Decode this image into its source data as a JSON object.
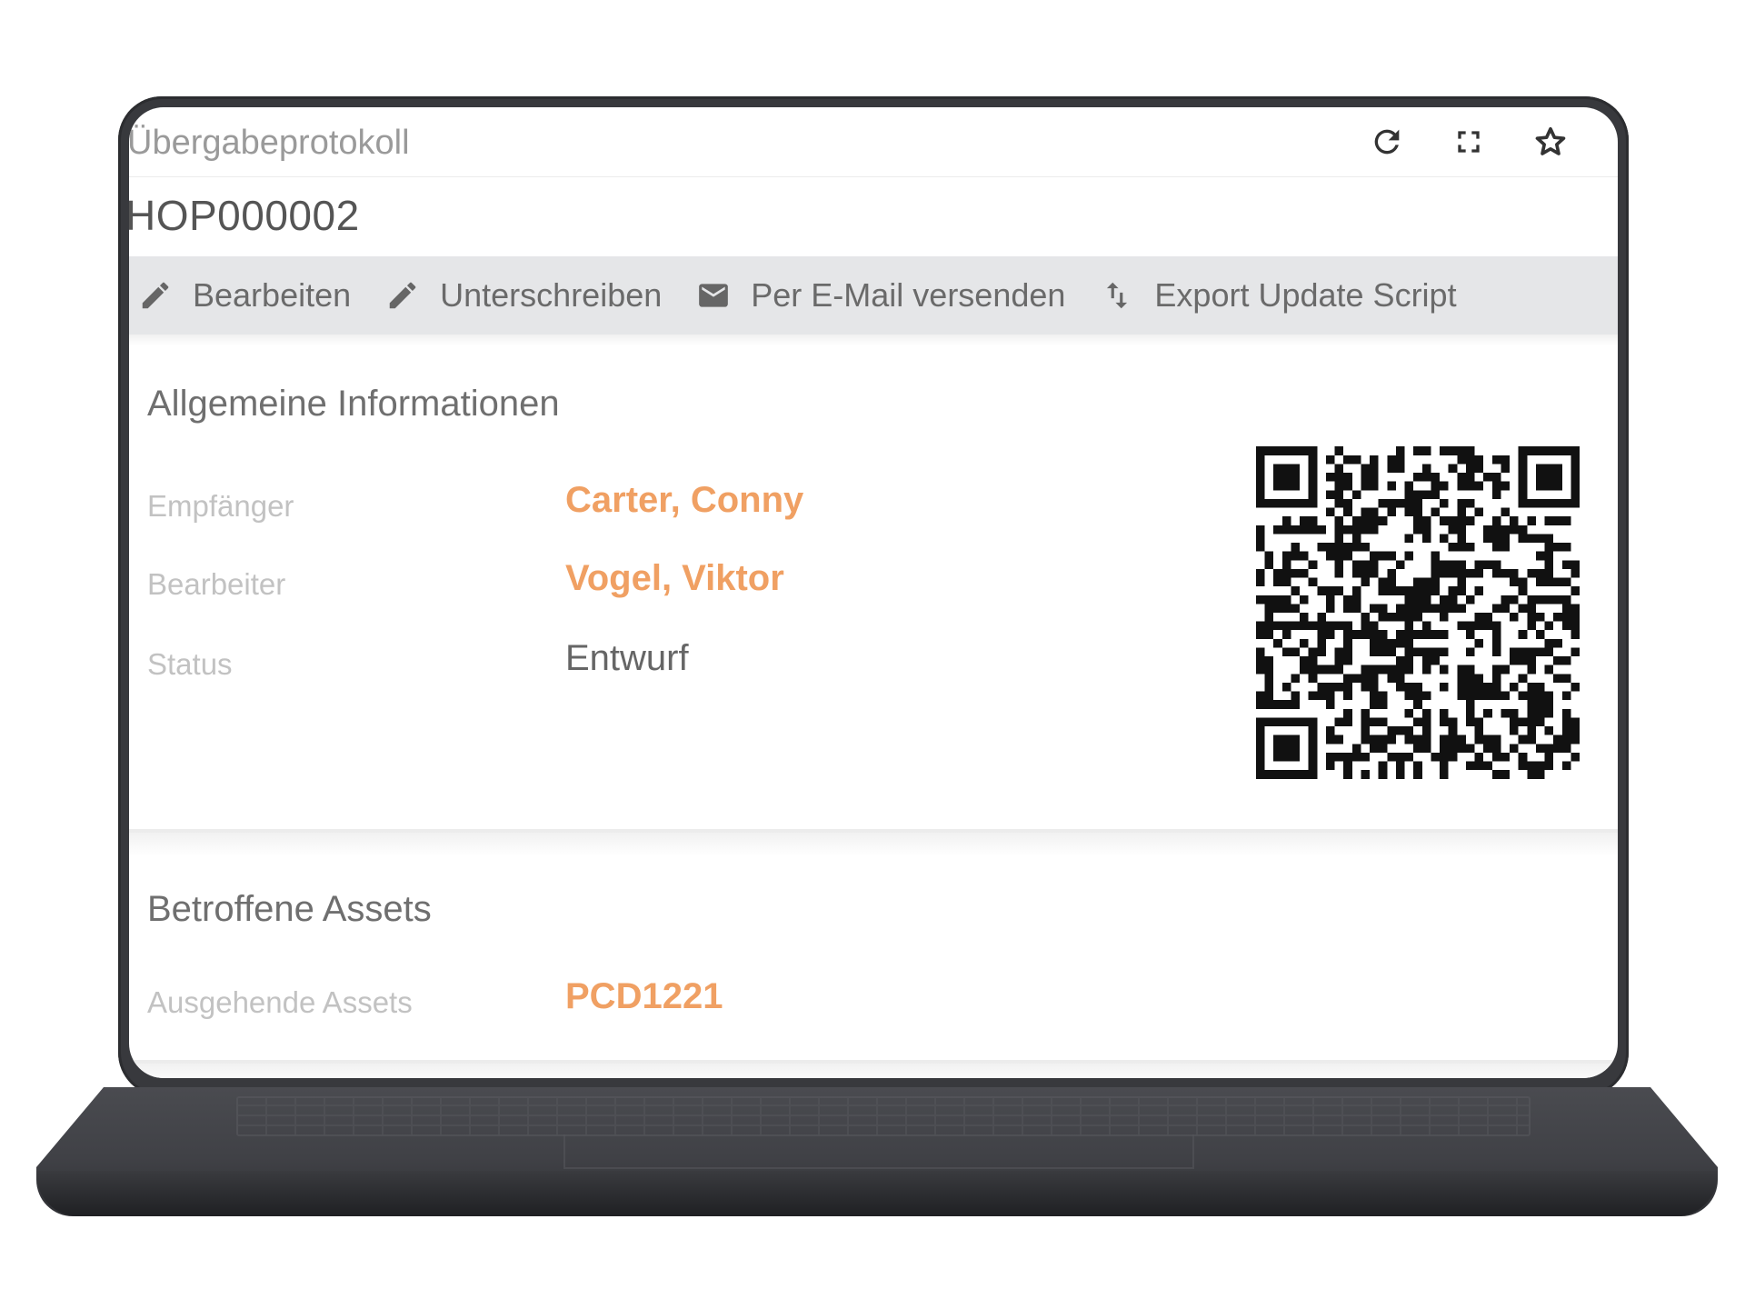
{
  "app": {
    "title": "Übergabeprotokoll"
  },
  "window_icons": [
    "refresh-icon",
    "fullscreen-icon",
    "star-icon"
  ],
  "document": {
    "id": "HOP000002"
  },
  "toolbar": {
    "edit_label": "Bearbeiten",
    "sign_label": "Unterschreiben",
    "email_label": "Per E-Mail versenden",
    "export_label": "Export Update Script"
  },
  "general": {
    "title": "Allgemeine Informationen",
    "fields": [
      {
        "label": "Empfänger",
        "value": "Carter, Conny"
      },
      {
        "label": "Bearbeiter",
        "value": "Vogel, Viktor"
      },
      {
        "label": "Status",
        "value": "Entwurf"
      }
    ]
  },
  "assets": {
    "title": "Betroffene Assets",
    "fields": [
      {
        "label": "Ausgehende Assets",
        "value": "PCD1221"
      }
    ]
  },
  "colors": {
    "link": "#f0a063",
    "toolbar_bg": "#e5e6e8",
    "device": "#38393d"
  }
}
